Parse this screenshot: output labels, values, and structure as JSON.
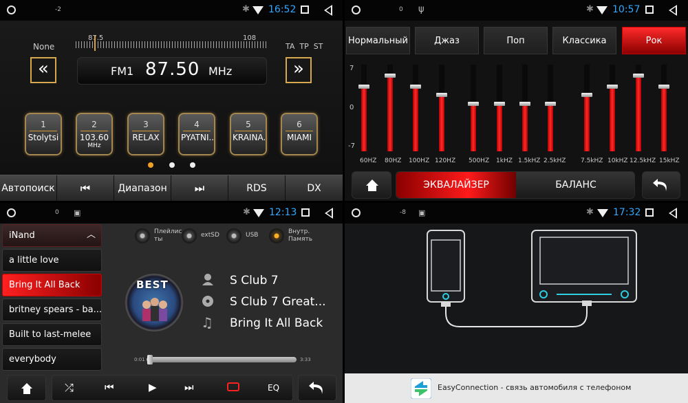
{
  "status_bars": [
    {
      "num": "-2",
      "time": "16:52"
    },
    {
      "num": "0",
      "time": "10:57"
    },
    {
      "num": "0",
      "time": "12:13"
    },
    {
      "num": "-8",
      "time": "17:32"
    }
  ],
  "radio": {
    "rds_label": "None",
    "scale_min": "87.5",
    "scale_max": "108",
    "band": "FM1",
    "frequency": "87.50",
    "unit": "MHz",
    "flags": "TA  TP  ST",
    "presets": [
      {
        "num": "1",
        "name": "Stolytsi",
        "sub": ""
      },
      {
        "num": "2",
        "name": "103.60",
        "sub": "MHz"
      },
      {
        "num": "3",
        "name": "RELAX",
        "sub": ""
      },
      {
        "num": "4",
        "name": "PYATNI...",
        "sub": ""
      },
      {
        "num": "5",
        "name": "KRAINA...",
        "sub": ""
      },
      {
        "num": "6",
        "name": "MIAMI",
        "sub": ""
      }
    ],
    "bottom": {
      "autosearch": "Автопоиск",
      "range": "Диапазон",
      "rds": "RDS",
      "dx": "DX"
    }
  },
  "equalizer": {
    "presets": [
      "Нормальный",
      "Джаз",
      "Поп",
      "Классика",
      "Рок"
    ],
    "selected_preset": "Рок",
    "axis": {
      "top": "7",
      "mid": "0",
      "bottom": "-7"
    },
    "bands": [
      "60HZ",
      "80HZ",
      "100HZ",
      "120HZ",
      "500HZ",
      "1kHZ",
      "1.5kHZ",
      "2.5kHZ",
      "7.5kHZ",
      "10kHZ",
      "12.5kHZ",
      "15kHZ"
    ],
    "gains": [
      3.5,
      5.2,
      3.5,
      2.1,
      0.7,
      0.7,
      0.7,
      0.7,
      2.1,
      3.5,
      5.2,
      3.5
    ],
    "tab_eq": "ЭКВАЛАЙЗЕР",
    "tab_balance": "БАЛАНС"
  },
  "music": {
    "sources": [
      "Плейлис ты",
      "extSD",
      "USB",
      "Внутр. Память"
    ],
    "selected_source": "Внутр. Память",
    "storage": "iNand",
    "playlist": [
      "a little love",
      "Bring It All Back",
      "britney spears - ba...",
      "Built to last-melee",
      "everybody"
    ],
    "selected_track": "Bring It All Back",
    "cover_text": "BEST",
    "artist": "S Club 7",
    "album": "S Club 7 Great...",
    "title": "Bring It All Back",
    "time_elapsed": "0:01",
    "time_total": "3:33",
    "progress": 0.005,
    "eq_label": "EQ"
  },
  "connect": {
    "app_name": "EasyConnection - связь автомобиля с телефоном"
  },
  "colors": {
    "accent_gold": "#d7a84c",
    "accent_red": "#ff2020",
    "clock_blue": "#31a8ff"
  }
}
